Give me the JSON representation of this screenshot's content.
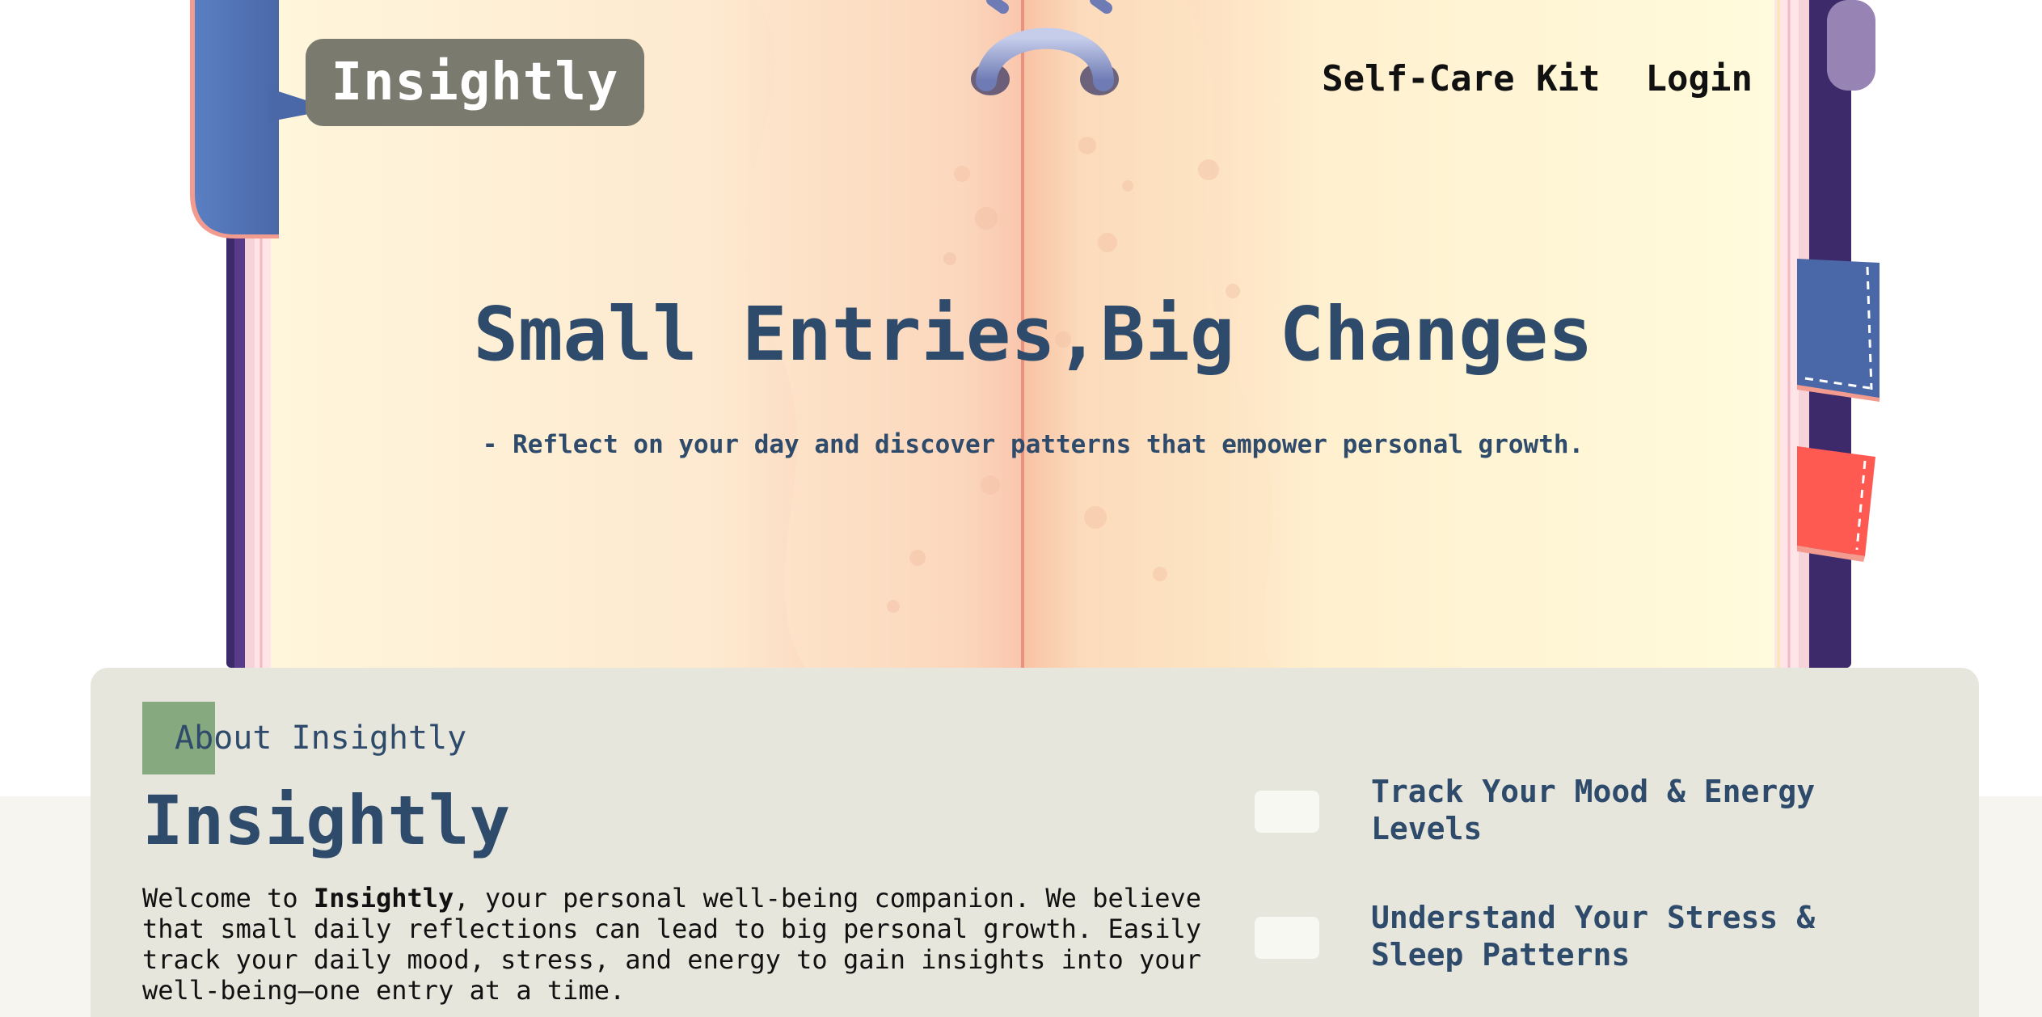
{
  "header": {
    "logo": "Insightly",
    "nav": [
      "Self-Care Kit",
      "Login"
    ]
  },
  "hero": {
    "title": "Small Entries,Big Changes",
    "subtitle": "- Reflect on your day and discover patterns that empower personal growth."
  },
  "about": {
    "tag": "About Insightly",
    "heading": "Insightly",
    "body_prefix": "Welcome to ",
    "body_brand": "Insightly",
    "body_rest": ", your personal well-being companion. We believe that small daily reflections can lead to big personal growth. Easily track your daily mood, stress, and energy to gain insights into your well-being—one entry at a time."
  },
  "features": [
    {
      "label": "Track Your Mood & Energy Levels"
    },
    {
      "label": "Understand Your Stress & Sleep Patterns"
    }
  ],
  "colors": {
    "brand_badge": "#7a7a6e",
    "heading_blue": "#2f4b6b",
    "about_card": "#e7e6dc",
    "tag_green": "#87a97f",
    "paper": "#fff8d8",
    "notebook_cover": "#3c2a6b"
  },
  "icons": {
    "notebook_ring": "ring-binder-icon",
    "bookmark_tabs": [
      "bookmark-blue-icon",
      "bookmark-red-icon"
    ]
  }
}
